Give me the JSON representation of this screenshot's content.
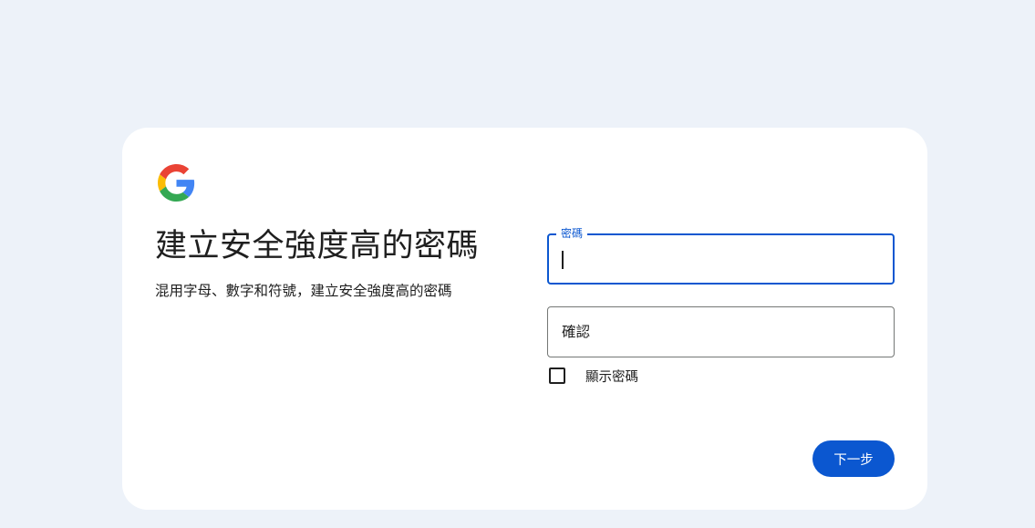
{
  "logo": {
    "icon": "google-g-icon",
    "colors": {
      "blue": "#4285F4",
      "red": "#EA4335",
      "yellow": "#FBBC05",
      "green": "#34A853"
    }
  },
  "heading": {
    "title": "建立安全強度高的密碼",
    "subtitle": "混用字母、數字和符號，建立安全強度高的密碼"
  },
  "form": {
    "password": {
      "label": "密碼",
      "value": ""
    },
    "confirm": {
      "label": "確認",
      "value": ""
    },
    "show_password": {
      "label": "顯示密碼",
      "checked": false
    }
  },
  "actions": {
    "next_label": "下一步"
  },
  "colors": {
    "accent": "#0b57d0",
    "background": "#edf2f9",
    "card": "#ffffff"
  }
}
